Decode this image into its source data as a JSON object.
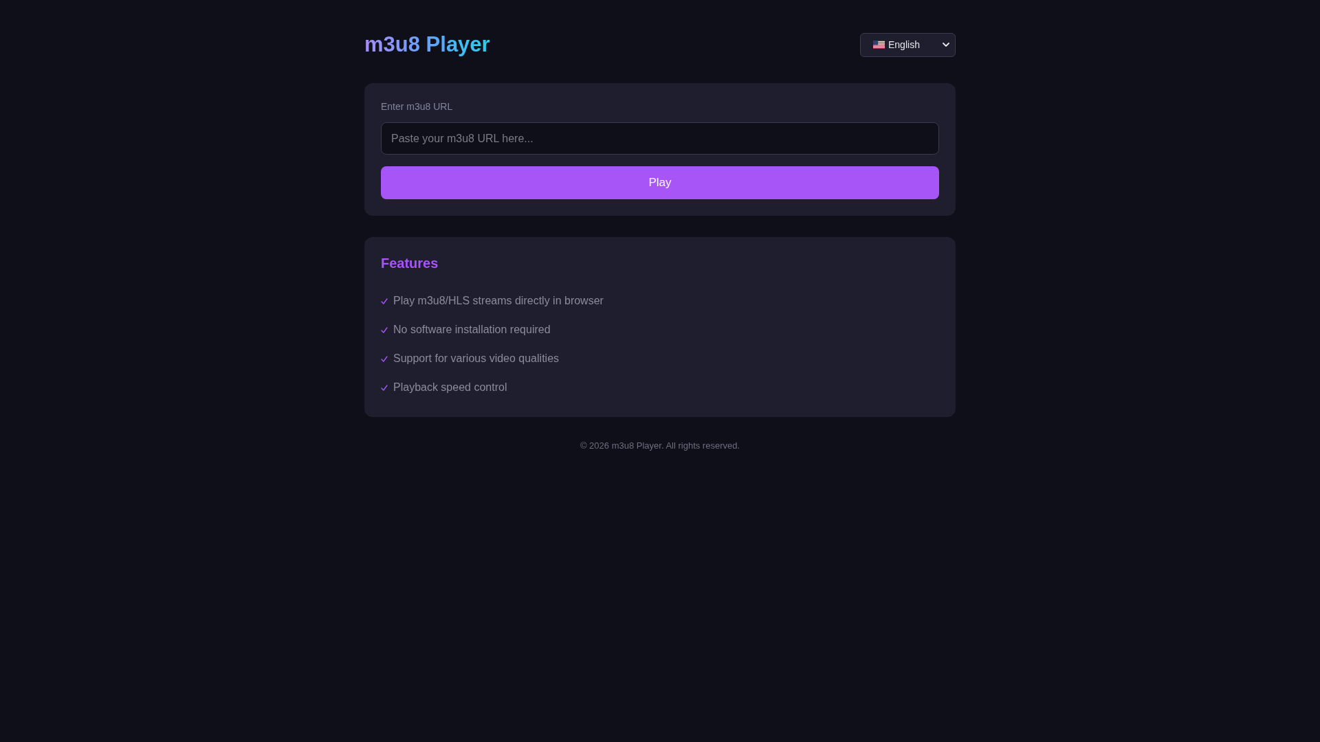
{
  "header": {
    "title": "m3u8 Player",
    "language_select": {
      "value": "English"
    }
  },
  "url_form": {
    "label": "Enter m3u8 URL",
    "input": {
      "placeholder": "Paste your m3u8 URL here..."
    },
    "button": "Play"
  },
  "features": {
    "title": "Features",
    "items": [
      "Play m3u8/HLS streams directly in browser",
      "No software installation required",
      "Support for various video qualities",
      "Playback speed control"
    ]
  },
  "footer": "© 2026 m3u8 Player. All rights reserved."
}
